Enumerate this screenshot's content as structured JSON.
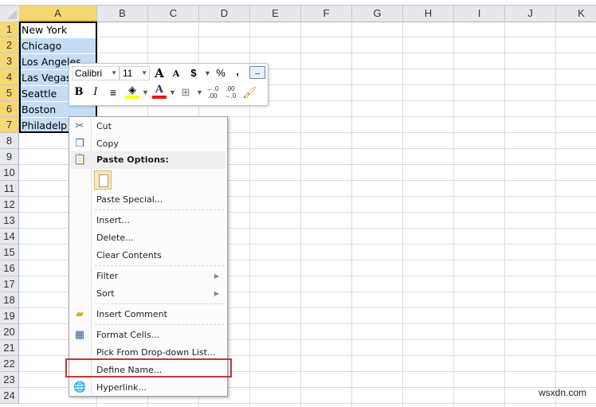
{
  "columns": [
    "A",
    "B",
    "C",
    "D",
    "E",
    "F",
    "G",
    "H",
    "I",
    "J",
    "K"
  ],
  "rows": [
    "1",
    "2",
    "3",
    "4",
    "5",
    "6",
    "7",
    "8",
    "9",
    "10",
    "11",
    "12",
    "13",
    "14",
    "15",
    "16",
    "17",
    "18",
    "19",
    "20",
    "21",
    "22",
    "23",
    "24"
  ],
  "cells": [
    "New York",
    "Chicago",
    "Los Angeles",
    "Las Vegas",
    "Seattle",
    "Boston",
    "Philadelp"
  ],
  "mini_toolbar": {
    "font_name": "Calibri",
    "font_size": "11",
    "grow_font": "A",
    "shrink_font": "A",
    "currency": "$",
    "percent": "%",
    "comma": ",",
    "bold": "B",
    "italic": "I",
    "fill_color": "#ffff00",
    "font_color": "#ff0000"
  },
  "context_menu": {
    "items": [
      {
        "label": "Cut",
        "icon": "scissors-icon"
      },
      {
        "label": "Copy",
        "icon": "copy-icon"
      },
      {
        "label": "Paste Options:",
        "icon": "paste-icon"
      },
      {
        "label": "Paste Special..."
      },
      {
        "label": "Insert..."
      },
      {
        "label": "Delete..."
      },
      {
        "label": "Clear Contents"
      },
      {
        "label": "Filter",
        "submenu": true
      },
      {
        "label": "Sort",
        "submenu": true
      },
      {
        "label": "Insert Comment",
        "icon": "comment-icon"
      },
      {
        "label": "Format Cells...",
        "icon": "format-cells-icon"
      },
      {
        "label": "Pick From Drop-down List..."
      },
      {
        "label": "Define Name..."
      },
      {
        "label": "Hyperlink...",
        "icon": "hyperlink-icon"
      }
    ]
  },
  "highlight_color": "#c0393b",
  "watermark": "wsxdn.com"
}
